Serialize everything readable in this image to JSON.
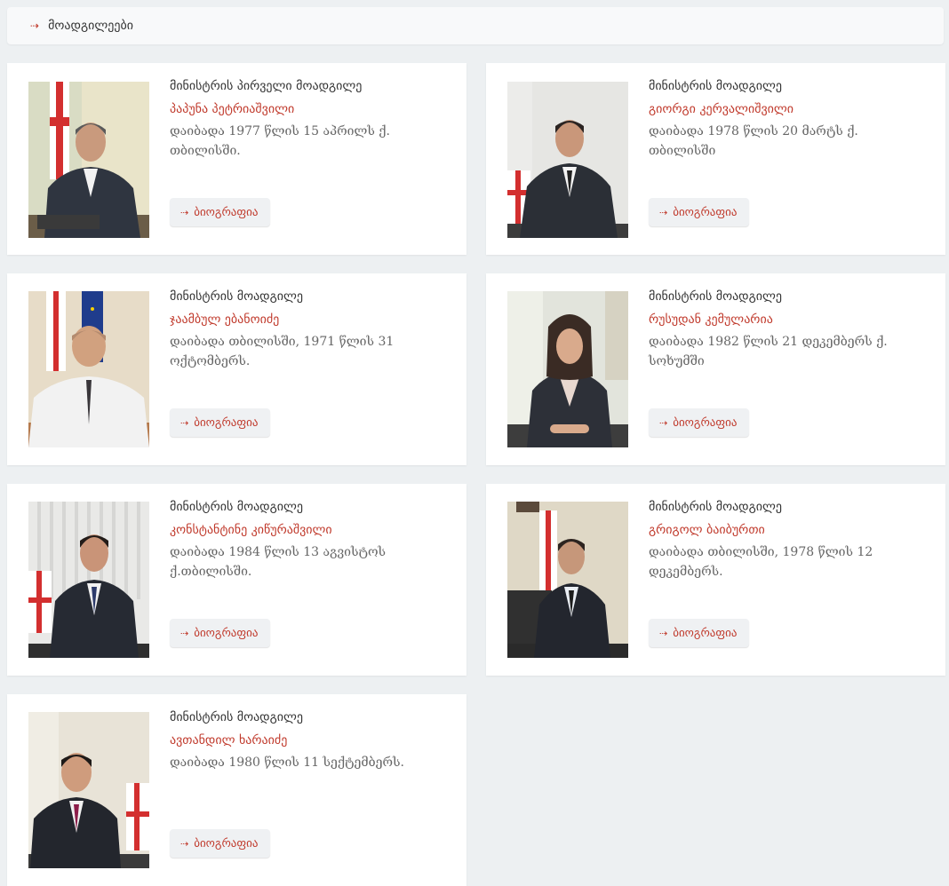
{
  "breadcrumb": {
    "arrow": "⇢",
    "label": "მოადგილეები"
  },
  "colors": {
    "accent": "#c0392b",
    "background": "#edf0f2",
    "card": "#ffffff"
  },
  "deputies": [
    {
      "role": "მინისტრის პირველი მოადგილე",
      "name": "პაპუნა პეტრიაშვილი",
      "born": "დაიბადა 1977 წლის 15 აპრილს ქ. თბილისში.",
      "button": "ბიოგრაფია",
      "arrow": "⇢"
    },
    {
      "role": "მინისტრის მოადგილე",
      "name": "გიორგი კერვალიშვილი",
      "born": "დაიბადა 1978 წლის 20 მარტს ქ. თბილისში",
      "button": "ბიოგრაფია",
      "arrow": "⇢"
    },
    {
      "role": "მინისტრის მოადგილე",
      "name": "ჯაამბულ ებანოიძე",
      "born": "დაიბადა თბილისში, 1971 წლის 31 ოქტომბერს.",
      "button": "ბიოგრაფია",
      "arrow": "⇢"
    },
    {
      "role": "მინისტრის მოადგილე",
      "name": "რუსუდან კემულარია",
      "born": "დაიბადა 1982 წლის 21 დეკემბერს ქ. სოხუმში",
      "button": "ბიოგრაფია",
      "arrow": "⇢"
    },
    {
      "role": "მინისტრის მოადგილე",
      "name": "კონსტანტინე კიწურაშვილი",
      "born": "დაიბადა 1984 წლის 13 აგვისტოს ქ.თბილისში.",
      "button": "ბიოგრაფია",
      "arrow": "⇢"
    },
    {
      "role": "მინისტრის მოადგილე",
      "name": "გრიგოლ ბაიბურთი",
      "born": "დაიბადა თბილისში, 1978 წლის 12 დეკემბერს.",
      "button": "ბიოგრაფია",
      "arrow": "⇢"
    },
    {
      "role": "მინისტრის მოადგილე",
      "name": "ავთანდილ ხარაიძე",
      "born": "დაიბადა 1980 წლის 11 სექტემბერს.",
      "button": "ბიოგრაფია",
      "arrow": "⇢"
    }
  ]
}
